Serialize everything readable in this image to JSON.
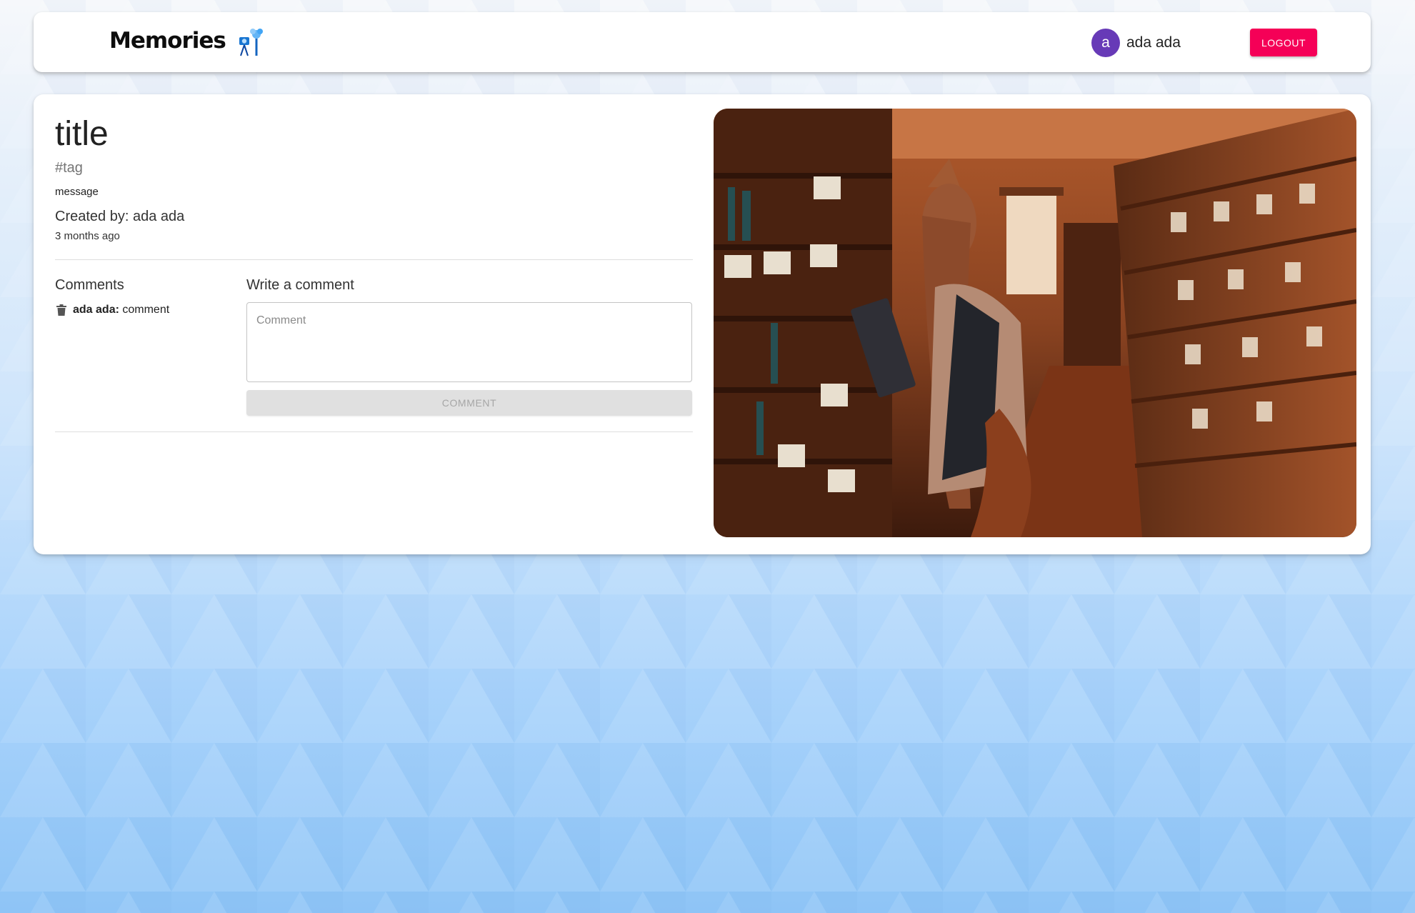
{
  "navbar": {
    "brand": "Memories",
    "brand_icon": "memories-logo-icon",
    "user": {
      "avatar_letter": "a",
      "name": "ada ada"
    },
    "logout_label": "LOGOUT"
  },
  "post": {
    "title": "title",
    "tags": "#tag",
    "message": "message",
    "created_by": "Created by: ada ada",
    "created_at": "3 months ago",
    "image_description": "photo"
  },
  "comments": {
    "heading": "Comments",
    "items": [
      {
        "author": "ada ada:",
        "text": "comment",
        "icon": "trash-icon"
      }
    ],
    "write_heading": "Write a comment",
    "input_placeholder": "Comment",
    "input_value": "",
    "submit_label": "COMMENT"
  },
  "colors": {
    "logout_button": "#f50057",
    "avatar": "#673ab7",
    "disabled_button": "#e0e0e0"
  }
}
